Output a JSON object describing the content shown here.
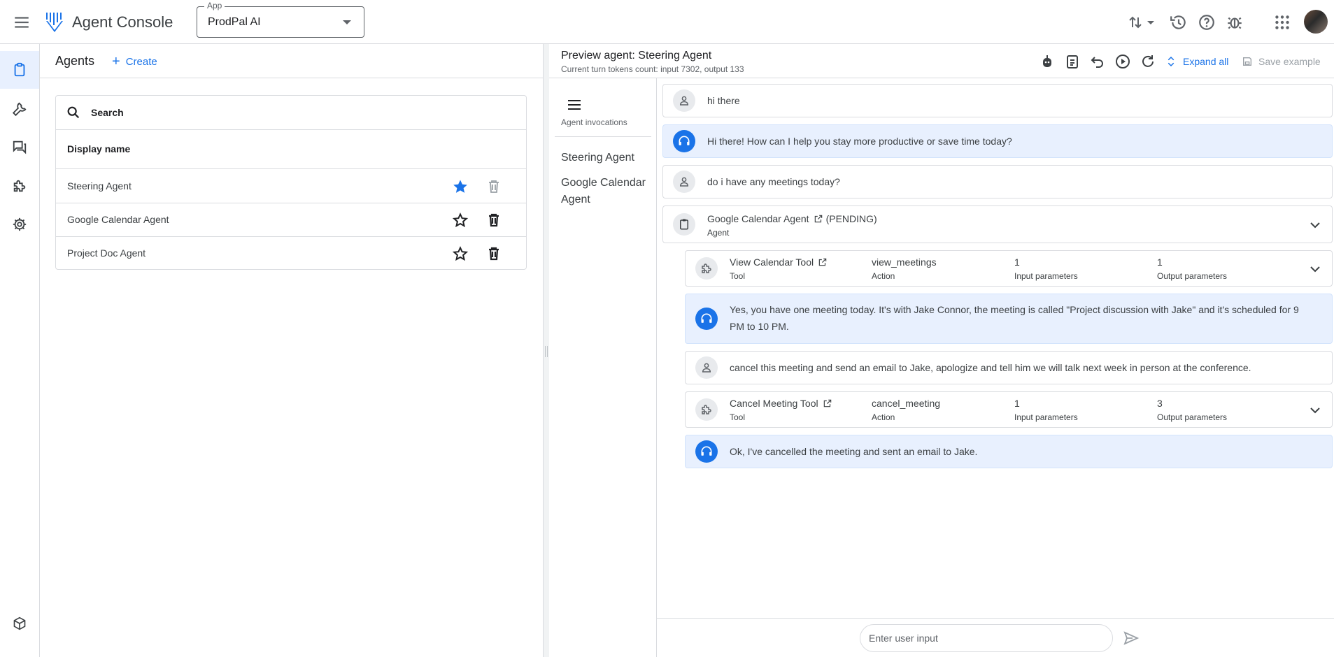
{
  "topbar": {
    "app_title": "Agent Console",
    "app_select_label": "App",
    "app_select_value": "ProdPal AI"
  },
  "agents_panel": {
    "title": "Agents",
    "create_label": "Create",
    "search_placeholder": "Search",
    "column_header": "Display name",
    "rows": [
      {
        "name": "Steering Agent",
        "starred": true
      },
      {
        "name": "Google Calendar Agent",
        "starred": false
      },
      {
        "name": "Project Doc Agent",
        "starred": false
      }
    ]
  },
  "preview": {
    "title": "Preview agent: Steering Agent",
    "tokens": "Current turn tokens count: input 7302, output 133",
    "expand_all": "Expand all",
    "save_example": "Save example",
    "invocations_label": "Agent invocations",
    "invocations": [
      "Steering Agent",
      "Google Calendar Agent"
    ],
    "messages": {
      "m1": "hi there",
      "m2": "Hi there! How can I help you stay more productive or save time today?",
      "m3": "do i have any meetings today?",
      "agent_call": {
        "name": "Google Calendar Agent",
        "status": "(PENDING)",
        "kind": "Agent"
      },
      "tool1": {
        "name": "View Calendar Tool",
        "kind": "Tool",
        "action": "view_meetings",
        "action_label": "Action",
        "inputs": "1",
        "inputs_label": "Input parameters",
        "outputs": "1",
        "outputs_label": "Output parameters"
      },
      "m4_line1": "Yes, you have one meeting today. It's with Jake Connor, the meeting is called \"Project discussion with Jake\" and it's scheduled for 9",
      "m4_line2": "PM to 10 PM.",
      "m5": "cancel this meeting and send an email to Jake, apologize and tell him we will talk next week in person at the conference.",
      "tool2": {
        "name": "Cancel Meeting Tool",
        "kind": "Tool",
        "action": "cancel_meeting",
        "action_label": "Action",
        "inputs": "1",
        "inputs_label": "Input parameters",
        "outputs": "3",
        "outputs_label": "Output parameters"
      },
      "m6": "Ok, I've cancelled the meeting and sent an email to Jake."
    },
    "input_placeholder": "Enter user input"
  },
  "colors": {
    "accent": "#1a73e8",
    "agent_bubble": "#e8f0fe",
    "border": "#dadce0"
  }
}
